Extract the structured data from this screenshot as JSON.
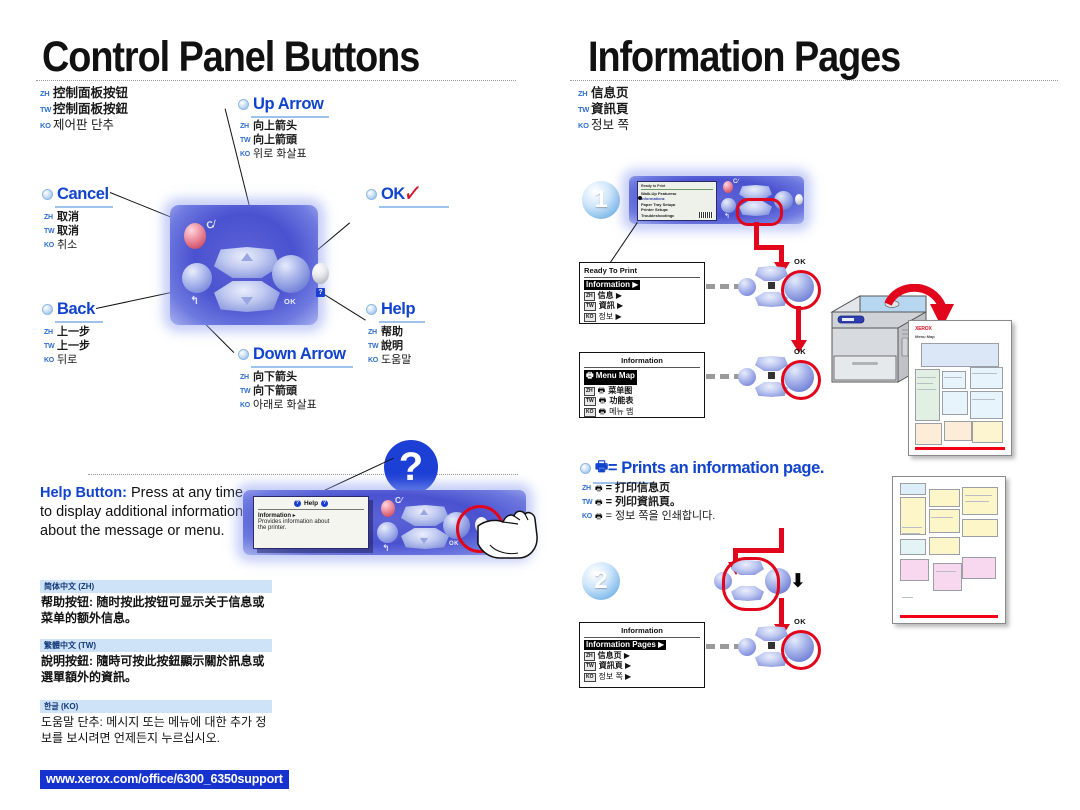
{
  "columns": {
    "left": {
      "title": "Control Panel Buttons",
      "langs": [
        {
          "tag": "ZH",
          "text": "控制面板按钮"
        },
        {
          "tag": "TW",
          "text": "控制面板按鈕"
        },
        {
          "tag": "KO",
          "text": "제어판 단추"
        }
      ]
    },
    "right": {
      "title": "Information Pages",
      "langs": [
        {
          "tag": "ZH",
          "text": "信息页"
        },
        {
          "tag": "TW",
          "text": "資訊頁"
        },
        {
          "tag": "KO",
          "text": "정보 쪽"
        }
      ]
    }
  },
  "callouts": {
    "up_arrow": {
      "label": "Up Arrow",
      "langs": [
        {
          "tag": "ZH",
          "text": "向上箭头"
        },
        {
          "tag": "TW",
          "text": "向上箭頭"
        },
        {
          "tag": "KO",
          "text": "위로 화살표"
        }
      ]
    },
    "cancel": {
      "label": "Cancel",
      "langs": [
        {
          "tag": "ZH",
          "text": "取消"
        },
        {
          "tag": "TW",
          "text": "取消"
        },
        {
          "tag": "KO",
          "text": "취소"
        }
      ]
    },
    "back": {
      "label": "Back",
      "langs": [
        {
          "tag": "ZH",
          "text": "上一步"
        },
        {
          "tag": "TW",
          "text": "上一步"
        },
        {
          "tag": "KO",
          "text": "뒤로"
        }
      ]
    },
    "ok": {
      "label": "OK",
      "check": "✓",
      "langs": []
    },
    "help": {
      "label": "Help",
      "langs": [
        {
          "tag": "ZH",
          "text": "帮助"
        },
        {
          "tag": "TW",
          "text": "說明"
        },
        {
          "tag": "KO",
          "text": "도움말"
        }
      ]
    },
    "down_arrow": {
      "label": "Down Arrow",
      "langs": [
        {
          "tag": "ZH",
          "text": "向下箭头"
        },
        {
          "tag": "TW",
          "text": "向下箭頭"
        },
        {
          "tag": "KO",
          "text": "아래로 화살표"
        }
      ]
    },
    "prints_page": {
      "icon": "🖶",
      "label": "= Prints an information page.",
      "langs": [
        {
          "tag": "ZH",
          "text": "= 打印信息页"
        },
        {
          "tag": "TW",
          "text": "= 列印資訊頁。"
        },
        {
          "tag": "KO",
          "text": "= 정보 쪽을 인쇄합니다."
        }
      ]
    }
  },
  "control_panel": {
    "ok_label": "OK",
    "back_glyph": "↰",
    "cancel_glyph": "C",
    "help_glyph": "?"
  },
  "help_note": {
    "bold": "Help Button:",
    "rest": " Press at any time to display additional information about the message or menu.",
    "qmark": "?"
  },
  "help_lcd": {
    "header": "Help",
    "header_icon": "?",
    "line1": "Information ▸",
    "line2": "Provides information about",
    "line3": "the printer."
  },
  "language_blocks": [
    {
      "bar": "简体中文 (ZH)",
      "body": "帮助按钮: 随时按此按钮可显示关于信息或菜单的额外信息。",
      "ko": false
    },
    {
      "bar": "繁體中文 (TW)",
      "body": "說明按鈕: 隨時可按此按鈕顯示關於訊息或選單額外的資訊。",
      "ko": false
    },
    {
      "bar": "한글 (KO)",
      "body": "도움말 단추: 메시지 또는 메뉴에 대한 추가 정보를 보시려면 언제든지 누르십시오.",
      "ko": true
    }
  ],
  "url": "www.xerox.com/office/6300_6350support",
  "steps": {
    "one": "1",
    "two": "2"
  },
  "panel_lcd_menu": {
    "header": "Ready to Print",
    "items": [
      "Walk-Up Features▸",
      "Information▸",
      "Paper Tray Setup▸",
      "Printer Setup▸",
      "Troubleshooting▸"
    ]
  },
  "lcd_screens": [
    {
      "name": "ready-to-print",
      "header": "Ready To Print",
      "header_center": false,
      "selected": "Information ▶",
      "selected_icon": "",
      "rows": [
        {
          "tag": "ZH",
          "icon": "",
          "text": "信息 ▶",
          "ko": false
        },
        {
          "tag": "TW",
          "icon": "",
          "text": "資訊 ▶",
          "ko": false
        },
        {
          "tag": "KO",
          "icon": "",
          "text": "정보 ▶",
          "ko": true
        }
      ]
    },
    {
      "name": "information-menu-map",
      "header": "Information",
      "header_center": true,
      "selected": "Menu Map",
      "selected_icon": "🖶",
      "rows": [
        {
          "tag": "ZH",
          "icon": "🖶",
          "text": "菜单图",
          "ko": false
        },
        {
          "tag": "TW",
          "icon": "🖶",
          "text": "功能表",
          "ko": false
        },
        {
          "tag": "KO",
          "icon": "🖶",
          "text": "메뉴 맵",
          "ko": true
        }
      ]
    },
    {
      "name": "information-pages",
      "header": "Information",
      "header_center": true,
      "selected": "Information Pages ▶",
      "selected_icon": "",
      "rows": [
        {
          "tag": "ZH",
          "icon": "",
          "text": "信息页 ▶",
          "ko": false
        },
        {
          "tag": "TW",
          "icon": "",
          "text": "資訊頁 ▶",
          "ko": false
        },
        {
          "tag": "KO",
          "icon": "",
          "text": "정보 쪽 ▶",
          "ko": true
        }
      ]
    }
  ],
  "ok_key_labels": {
    "a": "OK",
    "b": "OK",
    "c": "OK"
  },
  "printed_pages": {
    "menu_map_title": "Menu Map",
    "brand": "XEROX"
  },
  "colors": {
    "link_blue": "#1144cc",
    "accent_red": "#e1061c",
    "panel_blue": "#4a52cf",
    "bar_blue": "#cfe3f8",
    "url_blue": "#1733cf"
  }
}
